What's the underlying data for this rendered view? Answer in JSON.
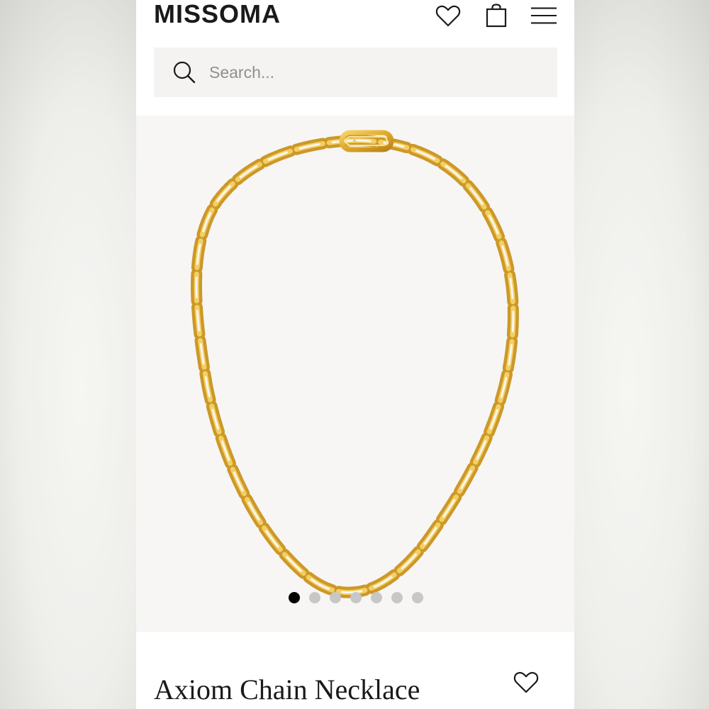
{
  "header": {
    "logo": "MISSOMA",
    "icons": [
      "heart-icon",
      "shopping-bag-icon",
      "menu-icon"
    ]
  },
  "search": {
    "placeholder": "Search...",
    "value": ""
  },
  "gallery": {
    "image": "gold-chain-necklace",
    "slide_count": 7,
    "active_slide": 1
  },
  "product": {
    "title": "Axiom Chain Necklace"
  },
  "colors": {
    "text": "#1a1a1a",
    "search_bg": "#f4f3f1",
    "gallery_bg": "#f7f6f4",
    "gold": "#e2ac2c",
    "dot_active": "#000000",
    "dot_inactive": "#c7c7c7"
  }
}
